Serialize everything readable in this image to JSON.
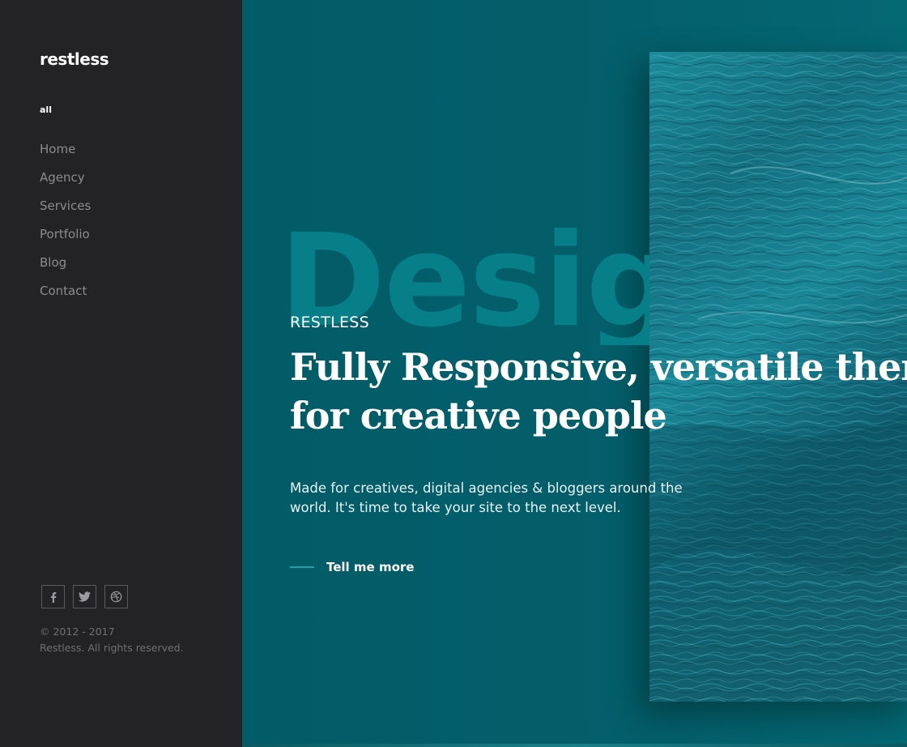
{
  "sidebar": {
    "logo": "restless",
    "filter": "all",
    "nav": [
      "Home",
      "Agency",
      "Services",
      "Portfolio",
      "Blog",
      "Contact"
    ],
    "social": [
      {
        "icon": "facebook-icon"
      },
      {
        "icon": "twitter-icon"
      },
      {
        "icon": "dribbble-icon"
      }
    ],
    "copyright_line1": "© 2012 - 2017",
    "copyright_line2": "Restless. All rights reserved."
  },
  "hero": {
    "background_word": "Design",
    "eyebrow": "RESTLESS",
    "headline_line1": "Fully Responsive, versatile theme",
    "headline_line2": "for creative people",
    "description_line1": "Made for creatives, digital agencies & bloggers around the",
    "description_line2": "world. It's time to take your site to the next level.",
    "cta_label": "Tell me more"
  },
  "colors": {
    "sidebar_bg": "#222227",
    "hero_bg": "#03606b",
    "accent": "#1aa1a9",
    "bg_word": "#067f89"
  }
}
